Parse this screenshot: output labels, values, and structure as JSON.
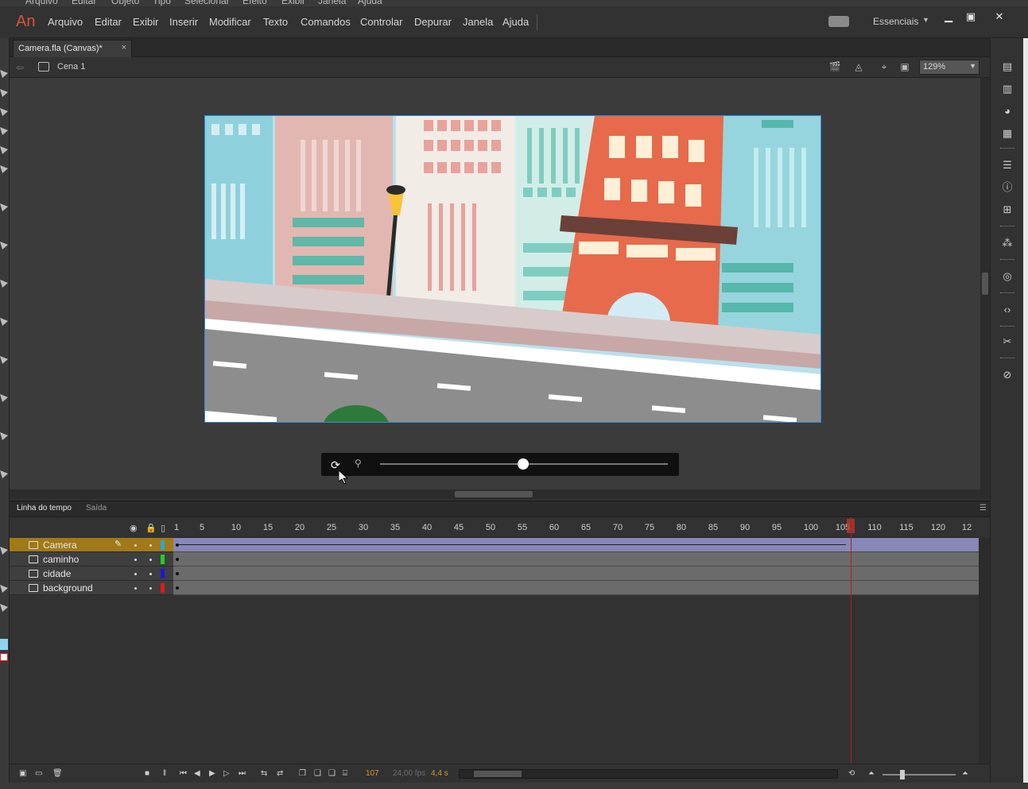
{
  "behind_menu": [
    "Arquivo",
    "Editar",
    "Objeto",
    "Tipo",
    "Selecionar",
    "Efeito",
    "Exibir",
    "Janela",
    "Ajuda"
  ],
  "app": {
    "logo": "An",
    "menu": [
      "Arquivo",
      "Editar",
      "Exibir",
      "Inserir",
      "Modificar",
      "Texto",
      "Comandos",
      "Controlar",
      "Depurar",
      "Janela",
      "Ajuda"
    ],
    "workspace": "Essenciais"
  },
  "document": {
    "tab_label": "Camera.fla (Canvas)*",
    "tab_close": "×"
  },
  "scene": {
    "label": "Cena 1",
    "zoom": "129%"
  },
  "timeline": {
    "tabs": [
      "Linha do tempo",
      "Saída"
    ],
    "ruler_ticks": [
      "1",
      "5",
      "10",
      "15",
      "20",
      "25",
      "30",
      "35",
      "40",
      "45",
      "50",
      "55",
      "60",
      "65",
      "70",
      "75",
      "80",
      "85",
      "90",
      "95",
      "100",
      "105",
      "110",
      "115",
      "120",
      "12"
    ],
    "layers": [
      {
        "name": "Camera",
        "color": "#2aa6d6",
        "active": true
      },
      {
        "name": "caminho",
        "color": "#1fd21f",
        "active": false
      },
      {
        "name": "cidade",
        "color": "#1a1ad6",
        "active": false
      },
      {
        "name": "background",
        "color": "#e21a1a",
        "active": false
      }
    ],
    "current_frame": "107",
    "fps": "24,00 fps",
    "time": "4,4 s"
  },
  "camera_bar": {
    "rotate_icon": "camera-rotate-icon",
    "zoom_icon": "camera-zoom-icon",
    "slider_value": 0.5
  },
  "colors": {
    "accent": "#d7553a",
    "stage_border": "#2a8ce6",
    "active_layer": "#a17a17",
    "playhead": "#b01e1e",
    "camera_frames": "#8787b8"
  }
}
